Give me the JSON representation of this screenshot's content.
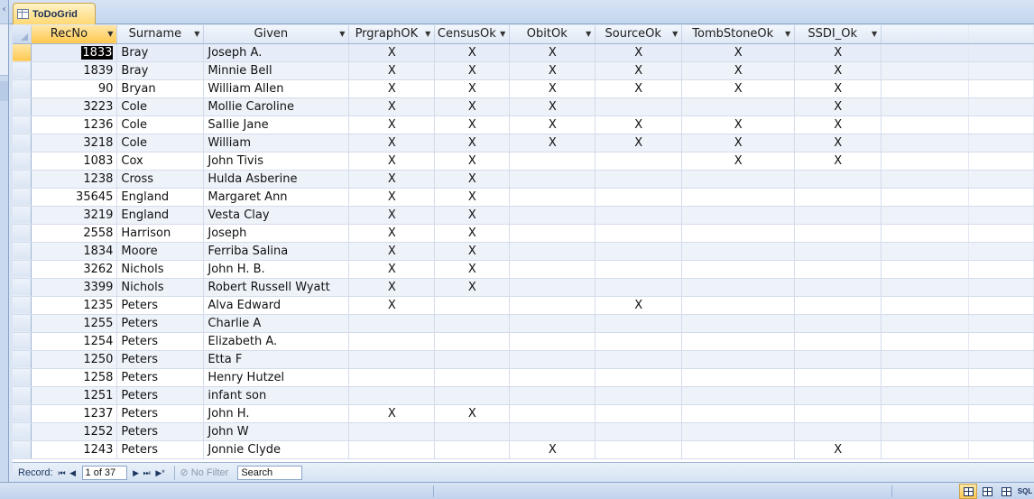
{
  "tab": {
    "title": "ToDoGrid"
  },
  "columns": [
    {
      "key": "recno",
      "label": "RecNo"
    },
    {
      "key": "surname",
      "label": "Surname"
    },
    {
      "key": "given",
      "label": "Given"
    },
    {
      "key": "prgraph",
      "label": "PrgraphOK"
    },
    {
      "key": "census",
      "label": "CensusOk"
    },
    {
      "key": "obit",
      "label": "ObitOk"
    },
    {
      "key": "source",
      "label": "SourceOk"
    },
    {
      "key": "tomb",
      "label": "TombStoneOk"
    },
    {
      "key": "ssdi",
      "label": "SSDI_Ok"
    }
  ],
  "rows": [
    [
      "1833",
      "Bray",
      "Joseph A.",
      "X",
      "X",
      "X",
      "X",
      "X",
      "X"
    ],
    [
      "1839",
      "Bray",
      "Minnie Bell",
      "X",
      "X",
      "X",
      "X",
      "X",
      "X"
    ],
    [
      "90",
      "Bryan",
      "William Allen",
      "X",
      "X",
      "X",
      "X",
      "X",
      "X"
    ],
    [
      "3223",
      "Cole",
      "Mollie Caroline",
      "X",
      "X",
      "X",
      "",
      "",
      "X"
    ],
    [
      "1236",
      "Cole",
      "Sallie Jane",
      "X",
      "X",
      "X",
      "X",
      "X",
      "X"
    ],
    [
      "3218",
      "Cole",
      "William",
      "X",
      "X",
      "X",
      "X",
      "X",
      "X"
    ],
    [
      "1083",
      "Cox",
      "John Tivis",
      "X",
      "X",
      "",
      "",
      "X",
      "X"
    ],
    [
      "1238",
      "Cross",
      "Hulda Asberine",
      "X",
      "X",
      "",
      "",
      "",
      ""
    ],
    [
      "35645",
      "England",
      "Margaret Ann",
      "X",
      "X",
      "",
      "",
      "",
      ""
    ],
    [
      "3219",
      "England",
      "Vesta Clay",
      "X",
      "X",
      "",
      "",
      "",
      ""
    ],
    [
      "2558",
      "Harrison",
      "Joseph",
      "X",
      "X",
      "",
      "",
      "",
      ""
    ],
    [
      "1834",
      "Moore",
      "Ferriba Salina",
      "X",
      "X",
      "",
      "",
      "",
      ""
    ],
    [
      "3262",
      "Nichols",
      "John H. B.",
      "X",
      "X",
      "",
      "",
      "",
      ""
    ],
    [
      "3399",
      "Nichols",
      "Robert Russell Wyatt",
      "X",
      "X",
      "",
      "",
      "",
      ""
    ],
    [
      "1235",
      "Peters",
      "Alva Edward",
      "X",
      "",
      "",
      "X",
      "",
      ""
    ],
    [
      "1255",
      "Peters",
      "Charlie A",
      "",
      "",
      "",
      "",
      "",
      ""
    ],
    [
      "1254",
      "Peters",
      "Elizabeth A.",
      "",
      "",
      "",
      "",
      "",
      ""
    ],
    [
      "1250",
      "Peters",
      "Etta F",
      "",
      "",
      "",
      "",
      "",
      ""
    ],
    [
      "1258",
      "Peters",
      "Henry Hutzel",
      "",
      "",
      "",
      "",
      "",
      ""
    ],
    [
      "1251",
      "Peters",
      "infant son",
      "",
      "",
      "",
      "",
      "",
      ""
    ],
    [
      "1237",
      "Peters",
      "John H.",
      "X",
      "X",
      "",
      "",
      "",
      ""
    ],
    [
      "1252",
      "Peters",
      "John W",
      "",
      "",
      "",
      "",
      "",
      ""
    ],
    [
      "1243",
      "Peters",
      "Jonnie Clyde",
      "",
      "",
      "X",
      "",
      "",
      "X"
    ]
  ],
  "recordNav": {
    "label": "Record:",
    "first": "⏮",
    "prev": "◀",
    "current": "1 of 37",
    "next": "▶",
    "last": "⏭",
    "newRecord": "▶*",
    "filter": "No Filter",
    "search": "Search"
  },
  "statusBar": {
    "sqlView": "SQL"
  }
}
